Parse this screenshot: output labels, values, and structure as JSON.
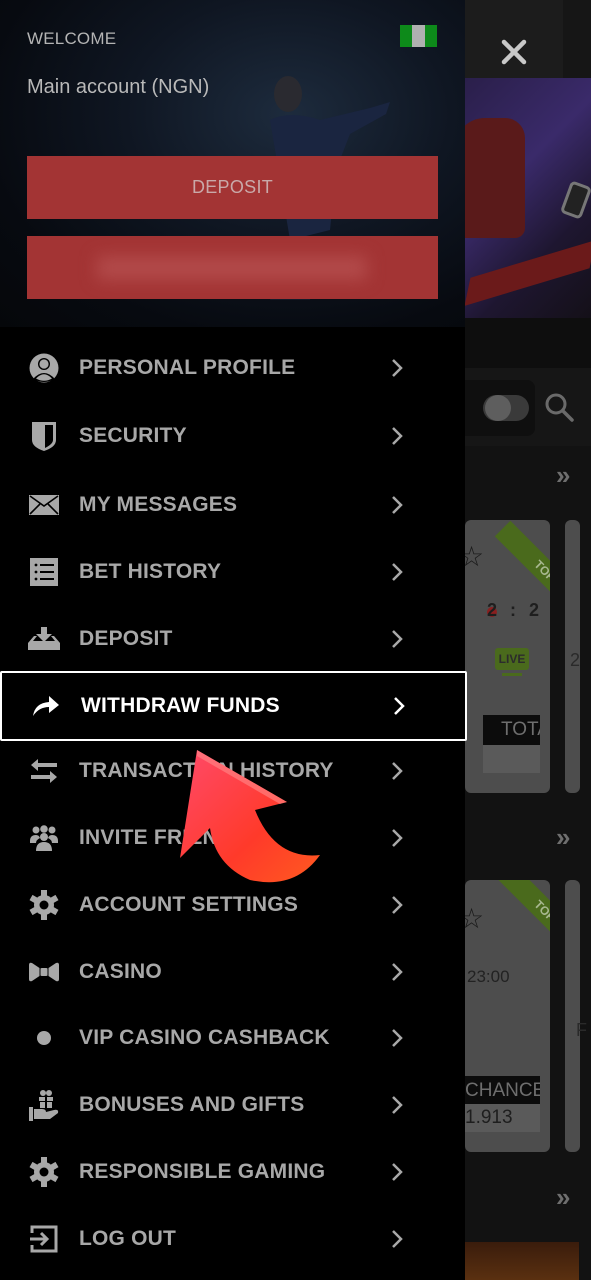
{
  "drawer": {
    "welcome_label": "WELCOME",
    "account_label": "Main account (NGN)",
    "flag_icon": "nigeria-flag",
    "deposit_button": "DEPOSIT",
    "secondary_button": "",
    "menu": [
      {
        "label": "PERSONAL PROFILE",
        "icon": "user-icon"
      },
      {
        "label": "SECURITY",
        "icon": "shield-icon"
      },
      {
        "label": "MY MESSAGES",
        "icon": "envelope-icon"
      },
      {
        "label": "BET HISTORY",
        "icon": "list-icon"
      },
      {
        "label": "DEPOSIT",
        "icon": "download-tray-icon"
      },
      {
        "label": "WITHDRAW FUNDS",
        "icon": "share-arrow-icon",
        "active": true
      },
      {
        "label": "TRANSACTION HISTORY",
        "icon": "swap-arrows-icon"
      },
      {
        "label": "INVITE FRIENDS",
        "icon": "group-icon"
      },
      {
        "label": "ACCOUNT SETTINGS",
        "icon": "gear-icon"
      },
      {
        "label": "CASINO",
        "icon": "bow-tie-icon"
      },
      {
        "label": "VIP CASINO CASHBACK",
        "icon": "dot-icon"
      },
      {
        "label": "BONUSES AND GIFTS",
        "icon": "gift-hand-icon"
      },
      {
        "label": "RESPONSIBLE GAMING",
        "icon": "gear-icon"
      },
      {
        "label": "LOG OUT",
        "icon": "logout-icon"
      }
    ]
  },
  "background": {
    "close_icon": "close-icon",
    "cards": [
      {
        "ribbon": "TOP",
        "score": "2 : 2",
        "live_badge": "LIVE",
        "market": "TOTA"
      },
      {
        "ribbon": "TOP",
        "time": "23:00",
        "market": "CHANCE",
        "odds": "1.913"
      }
    ],
    "partial_card_texts": [
      "2",
      "F"
    ]
  },
  "colors": {
    "accent_red": "#a33434",
    "active_border": "#ffffff",
    "menu_text": "#a8a8a8",
    "top_ribbon": "#4a6a1c"
  }
}
